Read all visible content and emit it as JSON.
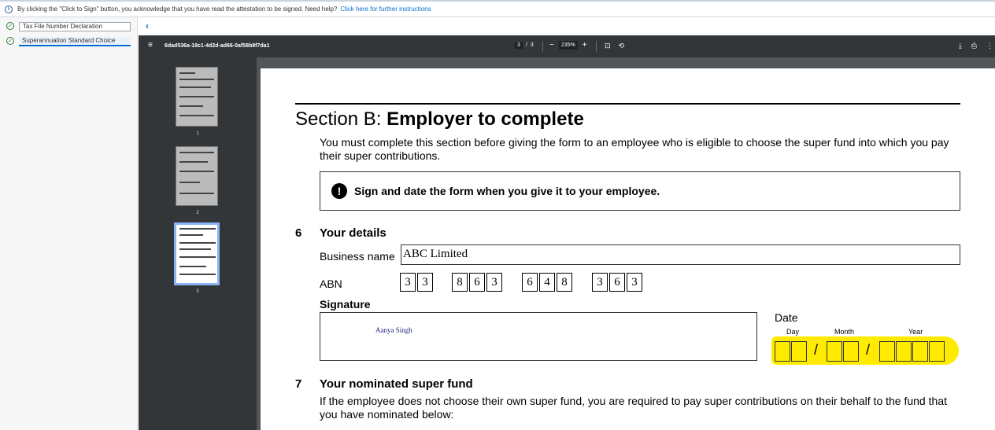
{
  "infobar": {
    "message": "By clicking the \"Click to Sign\" button, you acknowledge that you have read the attestation to be signed. Need help?",
    "help_link": "Click here for further instructions"
  },
  "sidebar": {
    "items": [
      {
        "label": "Tax File Number Declaration"
      },
      {
        "label": "Superannuation Standard Choice"
      }
    ]
  },
  "toolbar": {
    "doc_title": "6dad536a-19c1-4d2d-ad66-0af58b8f7da1",
    "current_page": "3",
    "page_sep": "/",
    "total_pages": "3",
    "zoom": "235%",
    "zoom_out": "−",
    "zoom_in": "+"
  },
  "thumbnails": [
    {
      "num": "1"
    },
    {
      "num": "2"
    },
    {
      "num": "3"
    }
  ],
  "form": {
    "section_prefix": "Section B: ",
    "section_title": "Employer to complete",
    "intro": "You must complete this section before giving the form to an employee who is eligible to choose the super fund into which you pay their super contributions.",
    "notice": "Sign and date the form when you give it to your employee.",
    "q6_num": "6",
    "q6_title": "Your details",
    "business_name_label": "Business name",
    "business_name_value": "ABC Limited",
    "abn_label": "ABN",
    "abn_groups": [
      [
        "3",
        "3"
      ],
      [
        "8",
        "6",
        "3"
      ],
      [
        "6",
        "4",
        "8"
      ],
      [
        "3",
        "6",
        "3"
      ]
    ],
    "signature_label": "Signature",
    "signature_value": "Aanya Singh",
    "date_label": "Date",
    "day_label": "Day",
    "month_label": "Month",
    "year_label": "Year",
    "date_sep": "/",
    "q7_num": "7",
    "q7_title": "Your nominated super fund",
    "q7_text": "If the employee does not choose their own super fund, you are required to pay super contributions on their behalf to the fund that you have nominated below:"
  },
  "colors": {
    "accent": "#0a6ed1",
    "highlight": "#ffeb00",
    "viewer_bg": "#525659",
    "toolbar_bg": "#323639"
  }
}
